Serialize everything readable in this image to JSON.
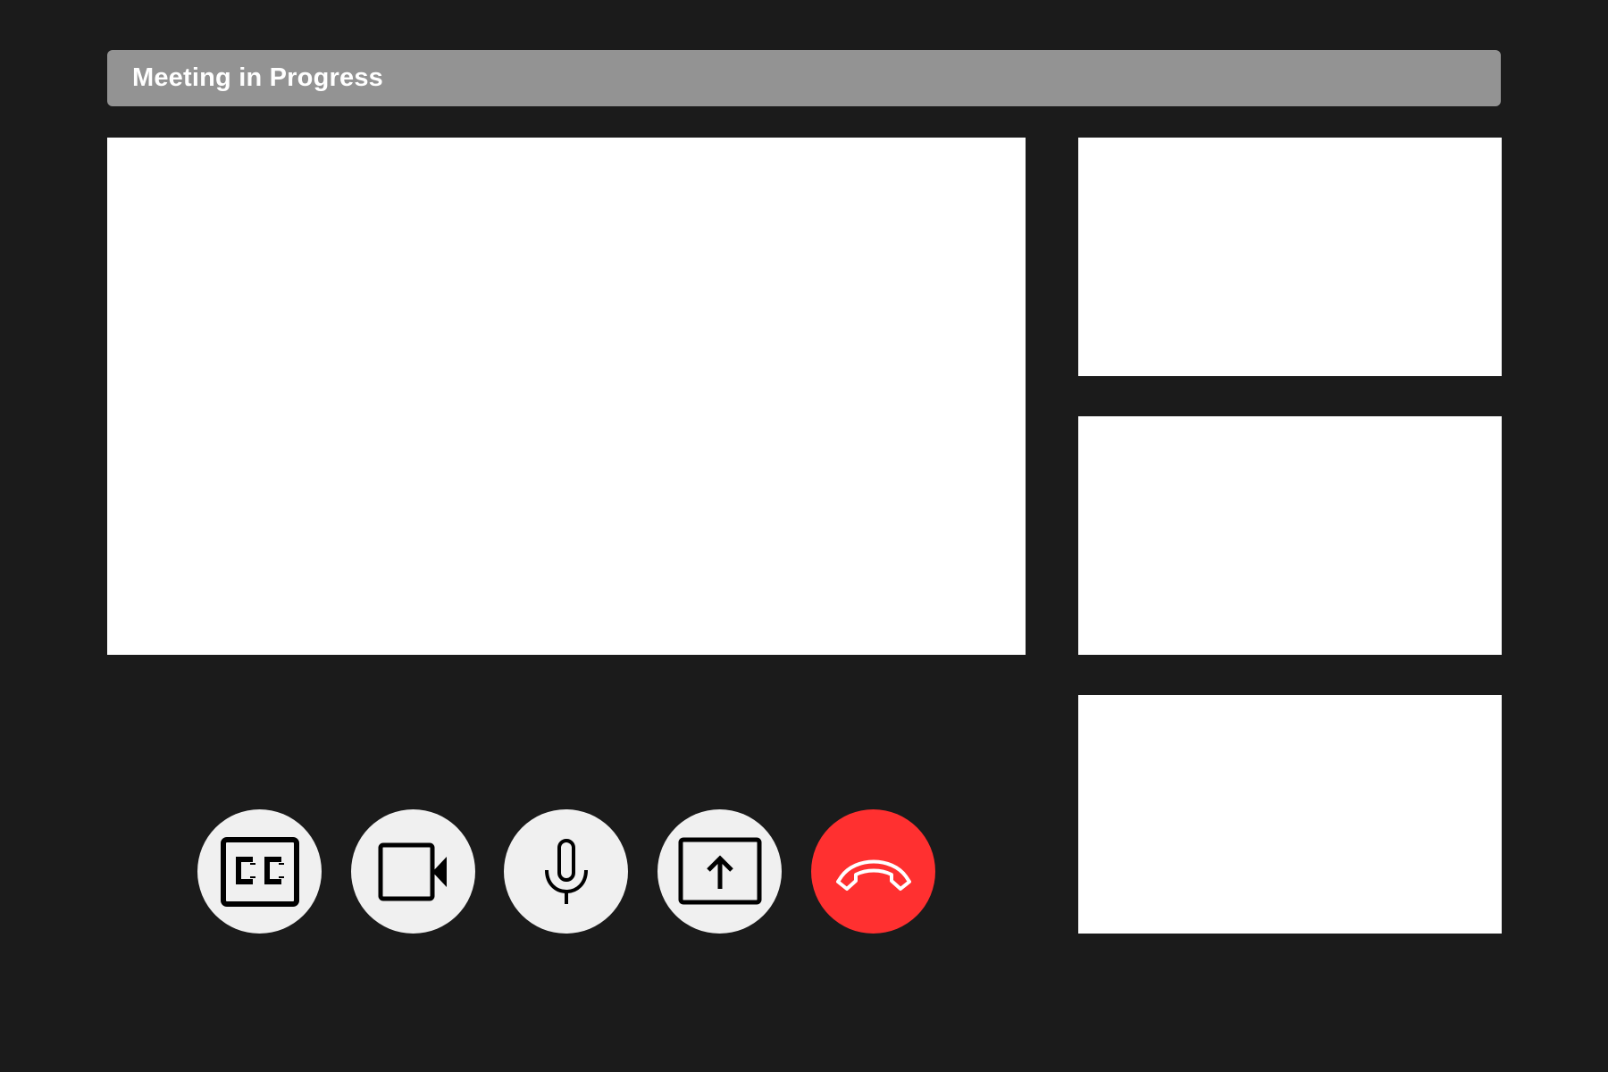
{
  "header": {
    "title": "Meeting in Progress"
  },
  "video": {
    "main_tile": "main-video-tile",
    "side_tiles": [
      "participant-tile-1",
      "participant-tile-2",
      "participant-tile-3"
    ]
  },
  "controls": [
    {
      "name": "captions-button",
      "icon": "closed-captions-icon"
    },
    {
      "name": "camera-button",
      "icon": "video-camera-icon"
    },
    {
      "name": "microphone-button",
      "icon": "microphone-icon"
    },
    {
      "name": "share-screen-button",
      "icon": "share-screen-icon"
    },
    {
      "name": "end-call-button",
      "icon": "hang-up-icon"
    }
  ],
  "colors": {
    "background": "#1b1b1b",
    "title_bar": "#939393",
    "tile": "#ffffff",
    "control_button": "#f0f0f0",
    "end_call": "#ff3030"
  }
}
